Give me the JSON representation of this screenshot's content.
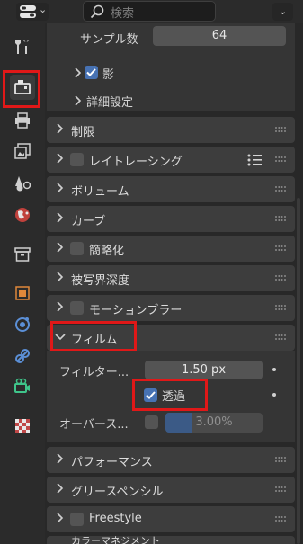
{
  "header": {
    "search_placeholder": "検索"
  },
  "tabs": [
    {
      "name": "tool",
      "icon": "wrench-screwdriver-icon"
    },
    {
      "name": "render",
      "icon": "camera-back-icon",
      "active": true
    },
    {
      "name": "output",
      "icon": "printer-icon"
    },
    {
      "name": "view-layer",
      "icon": "image-stack-icon"
    },
    {
      "name": "scene",
      "icon": "cone-sphere-icon"
    },
    {
      "name": "world",
      "icon": "globe-icon"
    },
    {
      "name": "collection",
      "icon": "box-icon"
    },
    {
      "name": "object",
      "icon": "square-orange-icon"
    },
    {
      "name": "modifiers",
      "icon": "physics-icon"
    },
    {
      "name": "particles",
      "icon": "constraint-icon"
    },
    {
      "name": "physics",
      "icon": "camera-data-icon"
    },
    {
      "name": "texture",
      "icon": "checker-icon"
    }
  ],
  "shadow_section": {
    "samples_label": "サンプル数",
    "samples_value": "64",
    "shadow_label": "影",
    "shadow_checked": true,
    "advanced_label": "詳細設定"
  },
  "panels": {
    "limits": "制限",
    "raytracing": "レイトレーシング",
    "volumes": "ボリューム",
    "curves": "カーブ",
    "simplify": "簡略化",
    "depth_of_field": "被写界深度",
    "motion_blur": "モーションブラー",
    "film": "フィルム",
    "performance": "パフォーマンス",
    "grease_pencil": "グリースペンシル",
    "freestyle": "Freestyle",
    "color_management": "カラーマネジメント"
  },
  "film": {
    "filter_label": "フィルター...",
    "filter_value": "1.50 px",
    "transparent_label": "透過",
    "transparent_checked": true,
    "overscan_label": "オーバース...",
    "overscan_checked": false,
    "overscan_value": "3.00%",
    "overscan_level": 0.03
  },
  "colors": {
    "highlight": "#e01818",
    "checkbox_on": "#4772b3",
    "panel_bg": "#3d3d3d"
  }
}
